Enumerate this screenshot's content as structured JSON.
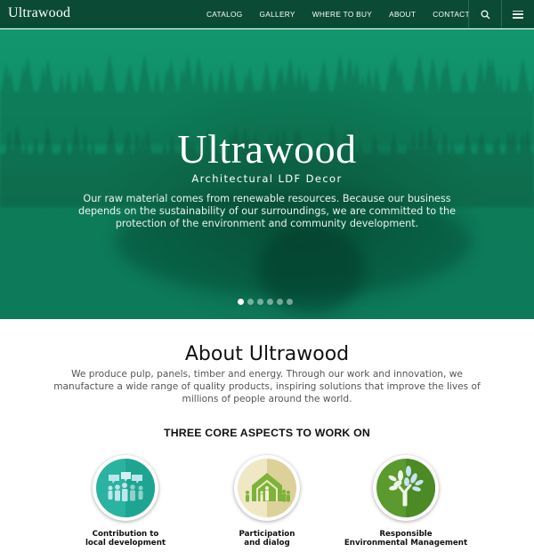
{
  "nav": {
    "logo": "Ultrawood",
    "menu": [
      "CATALOG",
      "GALLERY",
      "WHERE TO BUY",
      "ABOUT",
      "CONTACT"
    ],
    "search_icon": "search-icon",
    "menu_icon": "hamburger-icon"
  },
  "hero": {
    "title": "Ultrawood",
    "subtitle": "Architectural LDF Decor",
    "text": "Our raw material comes from renewable resources. Because our business depends on the sustainability of our surroundings, we are committed to the protection of the environment and community development.",
    "slides_total": 6,
    "active_slide": 1,
    "background": "misty-forest"
  },
  "about": {
    "title": "About Ultrawood",
    "text": "We produce pulp, panels, timber and energy. Through our work and innovation, we manufacture a wide range of quality products, inspiring solutions that improve the lives of millions of people around the world.",
    "core_title": "THREE CORE ASPECTS TO WORK ON",
    "aspects": [
      {
        "label_line1": "Contribution to",
        "label_line2": "local development",
        "icon": "people-dialog-icon",
        "color": "#2ab3a0"
      },
      {
        "label_line1": "Participation",
        "label_line2": "and dialog",
        "icon": "family-house-icon",
        "color": "#e8dfb0"
      },
      {
        "label_line1": "Responsible",
        "label_line2": "Environmental Management",
        "icon": "tree-hand-icon",
        "color": "#5a9a2e"
      }
    ]
  },
  "colors": {
    "nav_bg": "#0b4a35",
    "hero_green": "#0f8c66"
  }
}
